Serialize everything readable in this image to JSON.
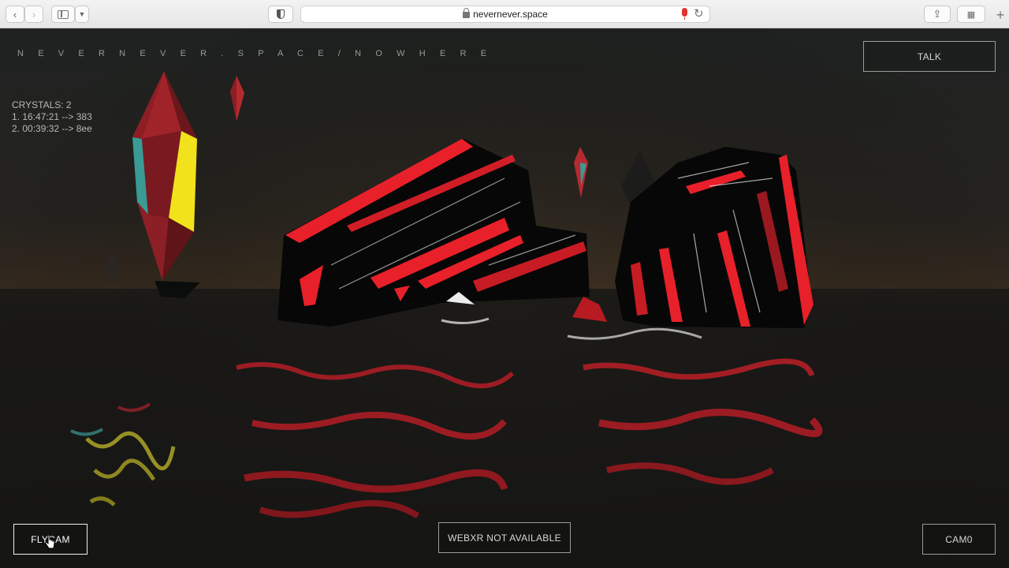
{
  "browser": {
    "url": "nevernever.space",
    "icons": [
      "chevron-left-icon",
      "chevron-right-icon",
      "sidebar-icon",
      "chevron-down-icon",
      "privacy-shield-icon",
      "lock-icon",
      "microphone-icon",
      "reload-icon",
      "share-icon",
      "tab-overview-icon",
      "new-tab-icon"
    ]
  },
  "brand": "N E V E R N E V E R . S P A C E / N O W H E R E",
  "hud": {
    "crystals": "CRYSTALS: 2",
    "entries": [
      "1. 16:47:21 --> 383",
      "2. 00:39:32 --> 8ee"
    ]
  },
  "buttons": {
    "talk": "TALK",
    "flycam": "FLYCAM",
    "webxr": "WEBXR NOT AVAILABLE",
    "cam0": "CAM0"
  },
  "colors": {
    "accent_red": "#e8202a",
    "crystal_teal": "#3a9a94",
    "crystal_yellow": "#f2e21c"
  }
}
